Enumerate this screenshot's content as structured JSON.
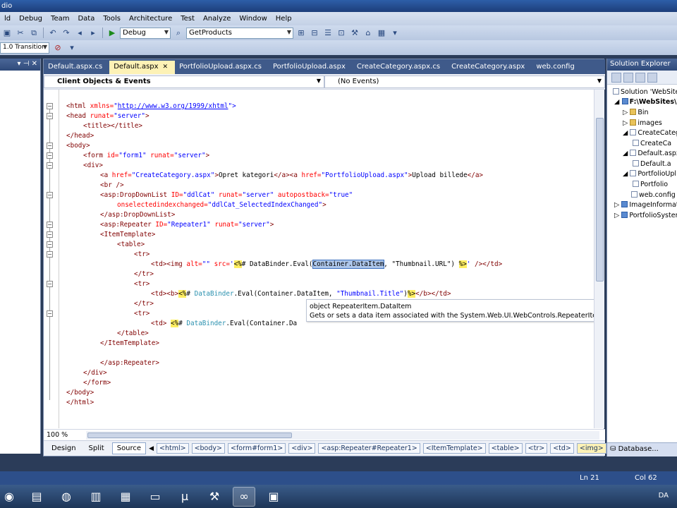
{
  "window": {
    "title": "dio"
  },
  "menu": [
    "ld",
    "Debug",
    "Team",
    "Data",
    "Tools",
    "Architecture",
    "Test",
    "Analyze",
    "Window",
    "Help"
  ],
  "toolbar": {
    "config": "Debug",
    "find": "GetProducts",
    "doctype": "1.0 Transition"
  },
  "tabs": [
    {
      "label": "Default.aspx.cs",
      "active": false
    },
    {
      "label": "Default.aspx",
      "active": true
    },
    {
      "label": "PortfolioUpload.aspx.cs",
      "active": false
    },
    {
      "label": "PortfolioUpload.aspx",
      "active": false
    },
    {
      "label": "CreateCategory.aspx.cs",
      "active": false
    },
    {
      "label": "CreateCategory.aspx",
      "active": false
    },
    {
      "label": "web.config",
      "active": false
    }
  ],
  "navbar": {
    "left": "Client Objects & Events",
    "right": "(No Events)"
  },
  "code": {
    "l1": [
      "<html ",
      "xmlns=",
      "\"",
      "http://www.w3.org/1999/xhtml",
      "\">"
    ],
    "l2": [
      "<head ",
      "runat=",
      "\"server\"",
      ">"
    ],
    "l3": "<title></title>",
    "l4": "</head>",
    "l5": "<body>",
    "l6": [
      "<form ",
      "id=",
      "\"form1\" ",
      "runat=",
      "\"server\"",
      ">"
    ],
    "l7": "<div>",
    "l8": [
      "<a ",
      "href=",
      "\"CreateCategory.aspx\"",
      ">",
      "Opret kategori",
      "</a><a ",
      "href=",
      "\"PortfolioUpload.aspx\"",
      ">",
      "Upload billede",
      "</a>"
    ],
    "l9": "<br />",
    "l10": [
      "<asp:DropDownList ",
      "ID=",
      "\"ddlCat\" ",
      "runat=",
      "\"server\" ",
      "autopostback=",
      "\"true\""
    ],
    "l11": [
      "onselectedindexchanged=",
      "\"ddlCat_SelectedIndexChanged\"",
      ">"
    ],
    "l12": "</asp:DropDownList>",
    "l13": [
      "<asp:Repeater ",
      "ID=",
      "\"Repeater1\" ",
      "runat=",
      "\"server\"",
      ">"
    ],
    "l14": "<ItemTemplate>",
    "l15": "<table>",
    "l16": "<tr>",
    "l17": [
      "<td><img ",
      "alt=",
      "\"\" ",
      "src=",
      "'",
      "<%",
      "# DataBinder.Eval(",
      "Container.DataItem",
      ", \"Thumbnail.URL\") ",
      "%>",
      "' ",
      "/></td>"
    ],
    "l18": "</tr>",
    "l19": "<tr>",
    "l20": [
      "<td><b>",
      "<%",
      "# ",
      "DataBinder",
      ".Eval(Container.DataItem, ",
      "\"Thumbnail.Title\"",
      ")",
      "%>",
      "</b></td>"
    ],
    "l21": "</tr>",
    "l22": "<tr>",
    "l23": [
      "<td> ",
      "<%",
      "# ",
      "DataBinder",
      ".Eval(Container.Da"
    ],
    "l24": "</table>",
    "l25": "</ItemTemplate>",
    "l26": "</asp:Repeater>",
    "l27": "</div>",
    "l28": "</form>",
    "l29": "</body>",
    "l30": "</html>"
  },
  "tooltip": {
    "title": "object RepeaterItem.DataItem",
    "desc": "Gets or sets a data item associated with the System.Web.UI.WebControls.RepeaterItem object in the System.Web.UI.WebControls"
  },
  "zoom": "100 %",
  "views": [
    "Design",
    "Split",
    "Source"
  ],
  "breadcrumb": [
    "<html>",
    "<body>",
    "<form#form1>",
    "<div>",
    "<asp:Repeater#Repeater1>",
    "<ItemTemplate>",
    "<table>",
    "<tr>",
    "<td>",
    "<img>"
  ],
  "solution": {
    "title": "Solution Explorer",
    "items": [
      "Solution 'WebSite",
      "F:\\WebSites\\W",
      "Bin",
      "images",
      "CreateCateg",
      "CreateCa",
      "Default.aspx",
      "Default.a",
      "PortfolioUpl",
      "Portfolio",
      "web.config",
      "ImageInformat",
      "PortfolioSystem"
    ],
    "bottom_tab": "Database..."
  },
  "status": {
    "ln": "Ln 21",
    "col": "Col 62"
  },
  "taskbar": {
    "lang": "DA"
  },
  "colors": {
    "tag": "#800000",
    "attr": "#ff0000",
    "value": "#0000ff",
    "highlight": "#ffee62"
  }
}
